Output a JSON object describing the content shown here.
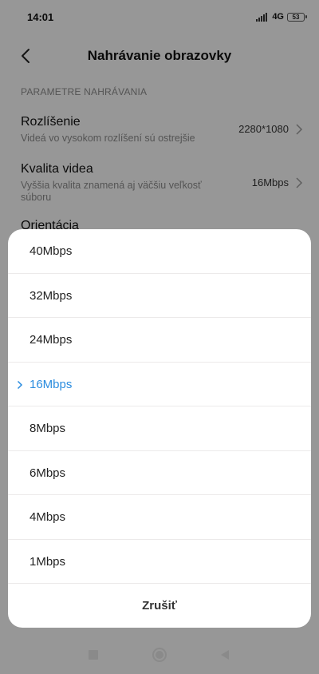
{
  "status_bar": {
    "time": "14:01",
    "network": "4G",
    "battery": "53"
  },
  "header": {
    "title": "Nahrávanie obrazovky",
    "back_icon": "chevron-left-icon"
  },
  "settings": {
    "section_header": "PARAMETRE NAHRÁVANIA",
    "items": [
      {
        "title": "Rozlíšenie",
        "subtitle": "Videá vo vysokom rozlíšení sú ostrejšie",
        "value": "2280*1080"
      },
      {
        "title": "Kvalita videa",
        "subtitle": "Vyššia kvalita znamená aj väčšiu veľkosť súboru",
        "value": "16Mbps"
      },
      {
        "title": "Orientácia"
      }
    ]
  },
  "sheet": {
    "options": [
      {
        "label": "40Mbps",
        "selected": false
      },
      {
        "label": "32Mbps",
        "selected": false
      },
      {
        "label": "24Mbps",
        "selected": false
      },
      {
        "label": "16Mbps",
        "selected": true
      },
      {
        "label": "8Mbps",
        "selected": false
      },
      {
        "label": "6Mbps",
        "selected": false
      },
      {
        "label": "4Mbps",
        "selected": false
      },
      {
        "label": "1Mbps",
        "selected": false
      }
    ],
    "cancel_label": "Zrušiť",
    "accent_color": "#2a8cdf"
  },
  "nav_bar": {
    "buttons": [
      "recents-square-icon",
      "home-circle-icon",
      "back-triangle-icon"
    ]
  }
}
